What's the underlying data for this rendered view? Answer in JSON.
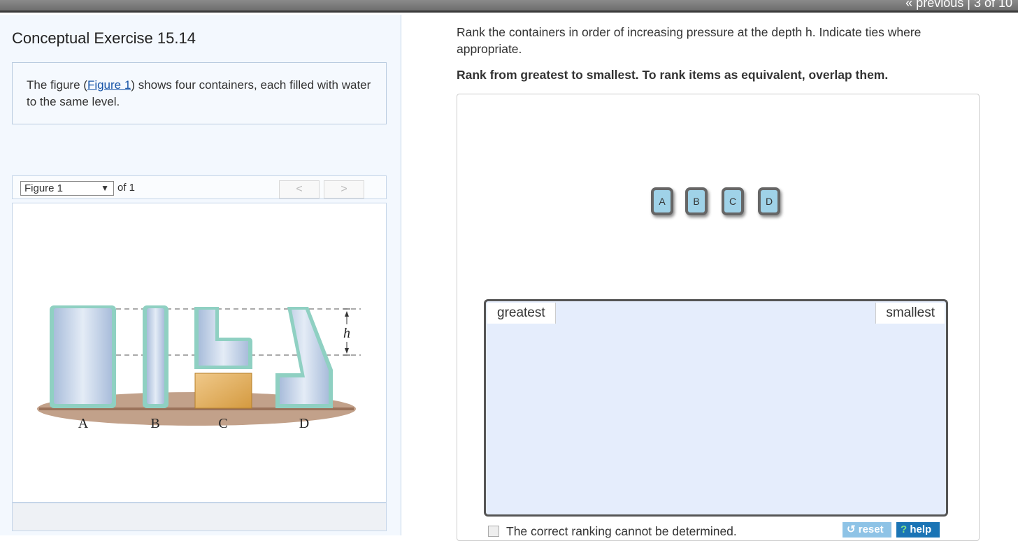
{
  "topbar": {
    "previous": "« previous",
    "separator": "|",
    "position": "3 of 10"
  },
  "title": "Conceptual Exercise 15.14",
  "intro": {
    "before": "The figure (",
    "link": "Figure 1",
    "after": ") shows four containers, each filled with water to the same level."
  },
  "figure_nav": {
    "selected": "Figure 1",
    "of": "of 1",
    "prev": "<",
    "next": ">"
  },
  "figure": {
    "labels": [
      "A",
      "B",
      "C",
      "D"
    ],
    "depth_label": "h"
  },
  "question": "Rank the containers in order of increasing pressure at the depth h. Indicate ties where appropriate.",
  "instruction": "Rank from greatest to smallest. To rank items as equivalent, overlap them.",
  "tiles": [
    "A",
    "B",
    "C",
    "D"
  ],
  "ranking": {
    "left": "greatest",
    "right": "smallest"
  },
  "checkbox_label": "The correct ranking cannot be determined.",
  "buttons": {
    "reset": "reset",
    "help": "help"
  }
}
